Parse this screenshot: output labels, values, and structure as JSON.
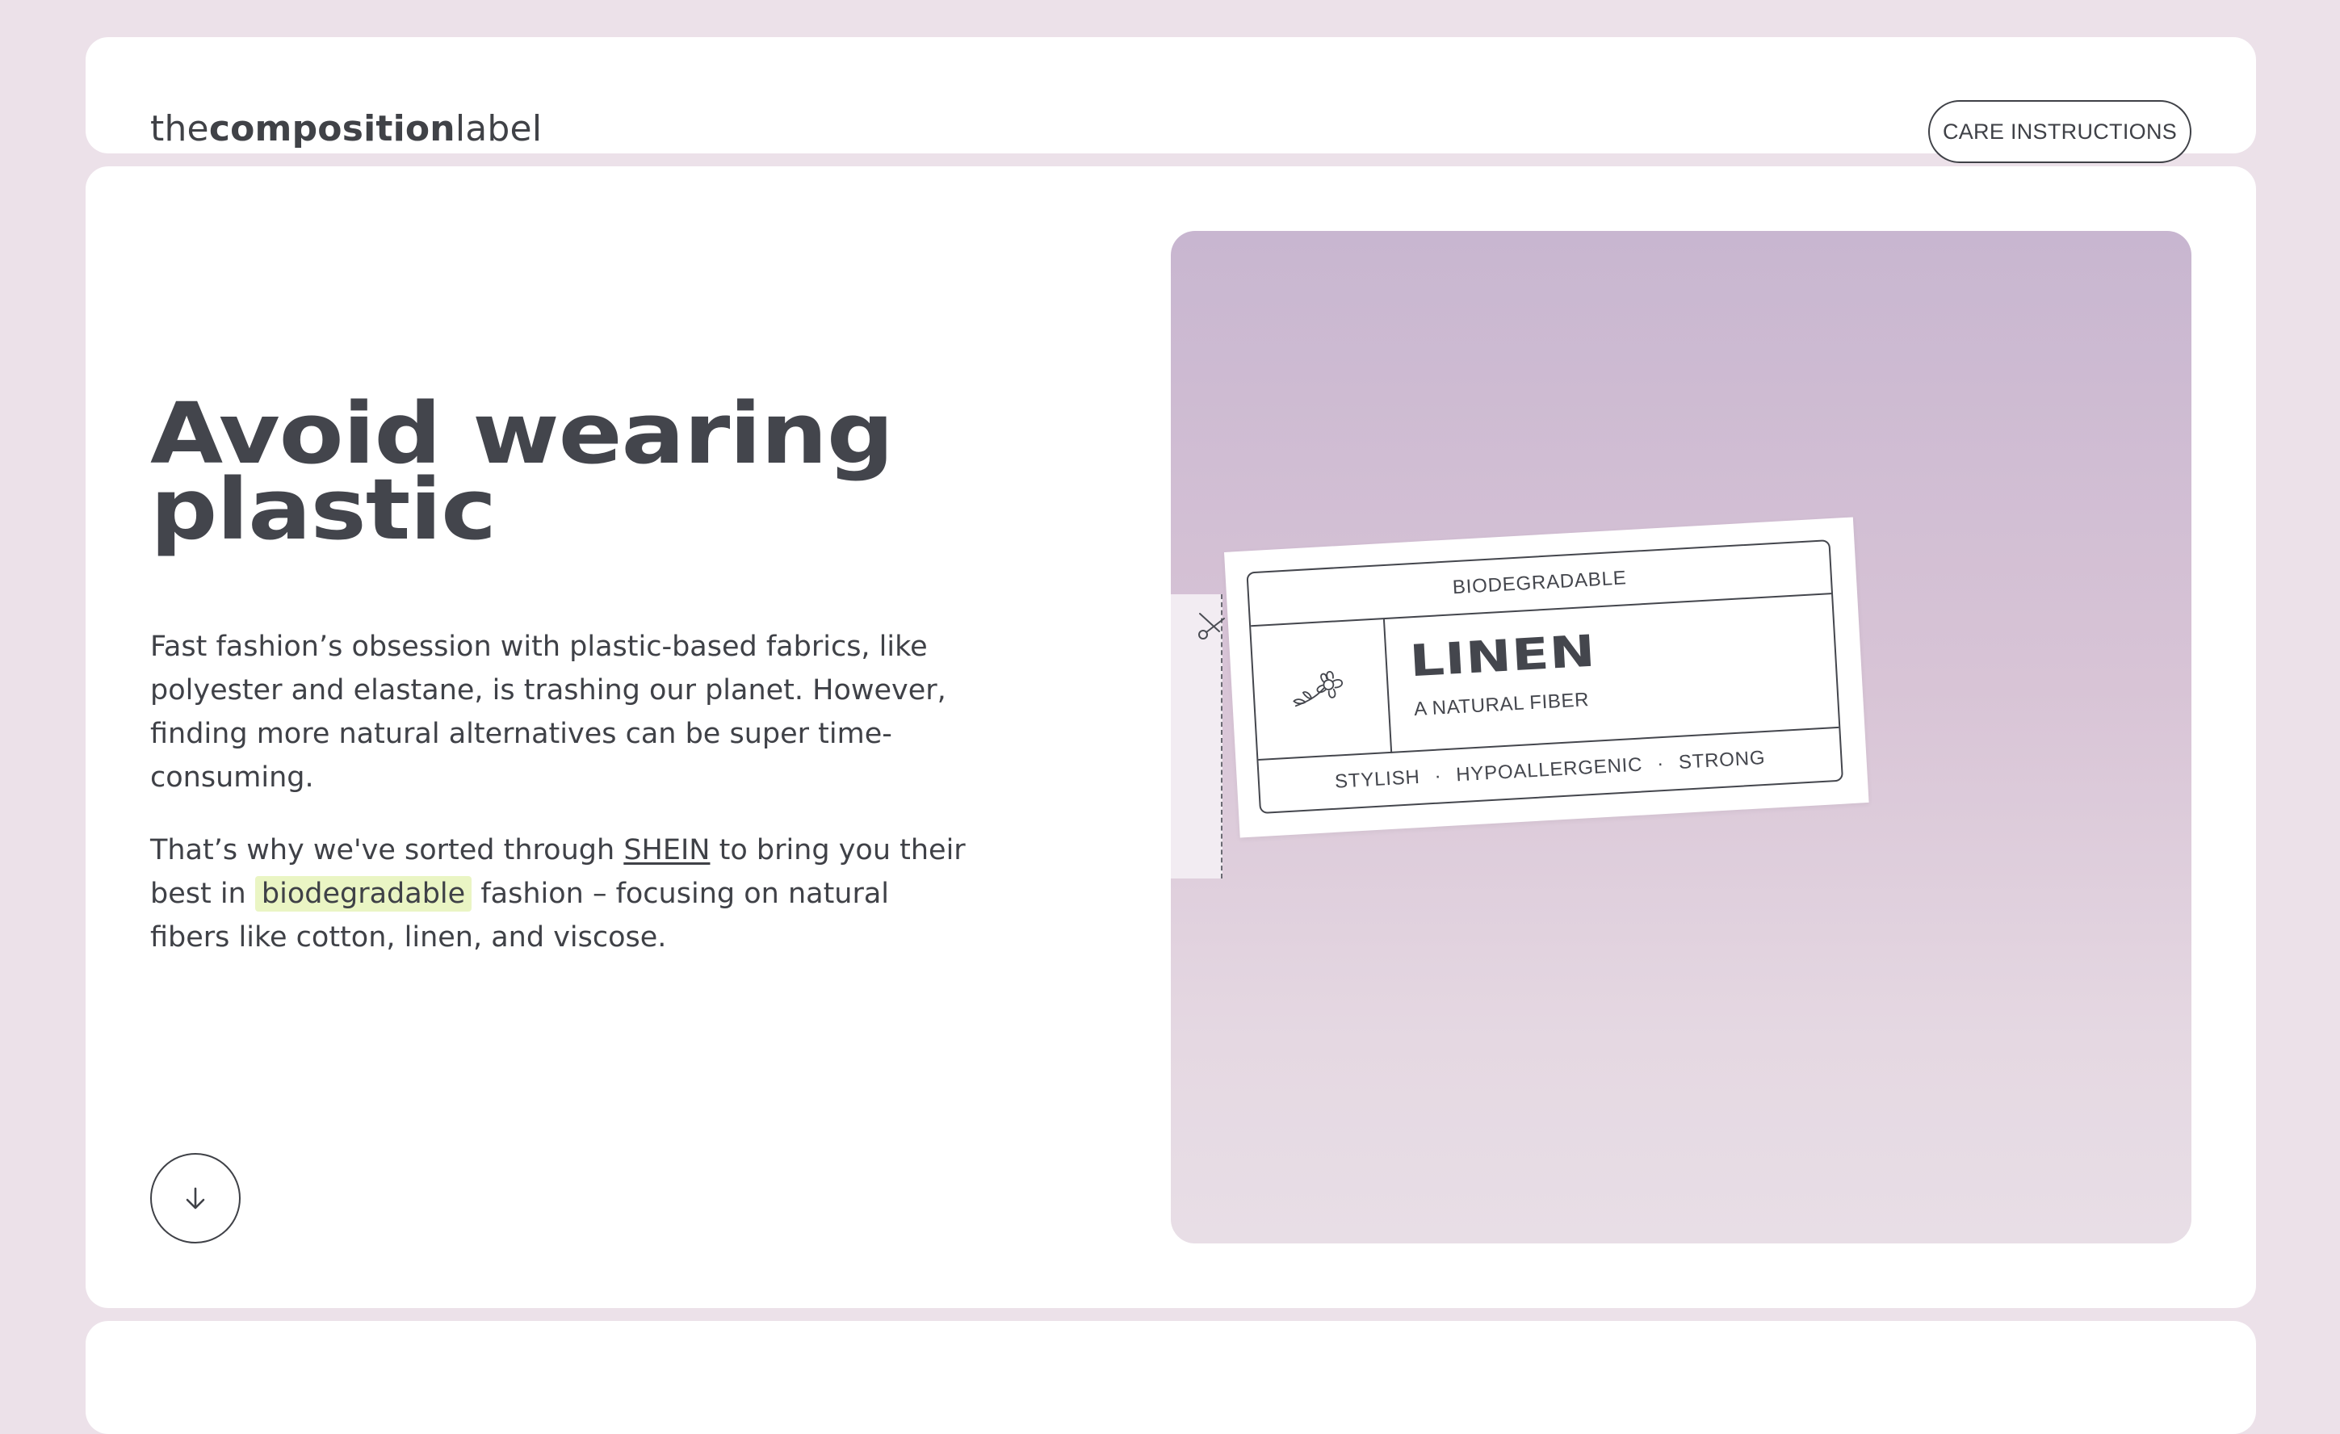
{
  "header": {
    "logo": {
      "prefix": "the",
      "bold": "composition",
      "suffix": "label"
    },
    "care_button_label": "CARE INSTRUCTIONS"
  },
  "hero": {
    "title_line1": "Avoid wearing",
    "title_line2": "plastic",
    "paragraph1": "Fast fashion’s obsession with plastic-based fabrics, like polyester and elastane, is trashing our planet. However, finding more natural alternatives can be super time-consuming.",
    "paragraph2": {
      "before_link": "That’s why we've sorted through ",
      "link_text": "SHEIN",
      "after_link": " to bring you their best in ",
      "highlight": "biodegradable",
      "end": " fashion – focusing on natural fibers like cotton, linen, and viscose."
    },
    "scroll_down_icon": "arrow-down-icon"
  },
  "label_tag": {
    "top_text": "BIODEGRADABLE",
    "fiber_name": "LINEN",
    "fiber_subtitle": "A NATURAL FIBER",
    "attributes": [
      "STYLISH",
      "HYPOALLERGENIC",
      "STRONG"
    ],
    "separator": "·",
    "icon": "flower-icon",
    "cut_icon": "scissors-icon"
  },
  "colors": {
    "page_background": "#ece1e9",
    "card_background": "#ffffff",
    "text": "#3f4147",
    "highlight": "#eaf5c4",
    "visual_gradient_top": "#c8b6d0",
    "visual_gradient_bottom": "#e8dee6"
  }
}
